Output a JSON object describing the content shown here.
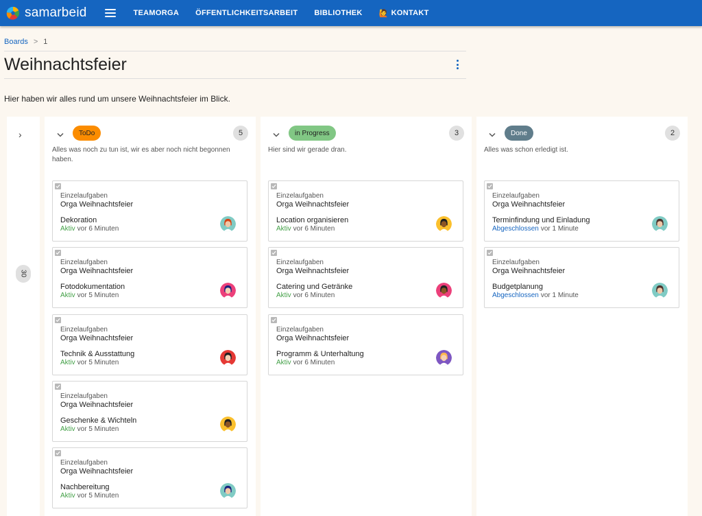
{
  "app": {
    "name": "samarbeid"
  },
  "nav": {
    "items": [
      {
        "label": "TEAMORGA"
      },
      {
        "label": "ÖFFENTLICHKEITSARBEIT"
      },
      {
        "label": "BIBLIOTHEK"
      },
      {
        "label": "KONTAKT",
        "emoji": "🙋"
      }
    ]
  },
  "breadcrumb": {
    "boards": "Boards",
    "sep": ">",
    "current": "1"
  },
  "page": {
    "title": "Weihnachtsfeier",
    "description": "Hier haben wir alles rund um unsere Weihnachtsfeier im Blick."
  },
  "collapsed_column": {
    "chevron": "›",
    "count": "30"
  },
  "columns": [
    {
      "label": "ToDo",
      "color": "#fb8c00",
      "text_color": "#222",
      "count": "5",
      "description": "Alles was noch zu tun ist, wir es aber noch nicht begonnen haben.",
      "cards": [
        {
          "category": "Einzelaufgaben",
          "project": "Orga Weihnachtsfeier",
          "task": "Dekoration",
          "status": "Aktiv",
          "status_type": "aktiv",
          "time": "vor 6 Minuten",
          "avatar_bg": "#80cbc4",
          "skin": "#f0c8a8",
          "hair": "#d84315"
        },
        {
          "category": "Einzelaufgaben",
          "project": "Orga Weihnachtsfeier",
          "task": "Fotodokumentation",
          "status": "Aktiv",
          "status_type": "aktiv",
          "time": "vor 5 Minuten",
          "avatar_bg": "#ec407a",
          "skin": "#f5d0b5",
          "hair": "#1a237e"
        },
        {
          "category": "Einzelaufgaben",
          "project": "Orga Weihnachtsfeier",
          "task": "Technik & Ausstattung",
          "status": "Aktiv",
          "status_type": "aktiv",
          "time": "vor 5 Minuten",
          "avatar_bg": "#e53935",
          "skin": "#f5d0b5",
          "hair": "#212121"
        },
        {
          "category": "Einzelaufgaben",
          "project": "Orga Weihnachtsfeier",
          "task": "Geschenke & Wichteln",
          "status": "Aktiv",
          "status_type": "aktiv",
          "time": "vor 5 Minuten",
          "avatar_bg": "#fbc02d",
          "skin": "#8d5524",
          "hair": "#212121"
        },
        {
          "category": "Einzelaufgaben",
          "project": "Orga Weihnachtsfeier",
          "task": "Nachbereitung",
          "status": "Aktiv",
          "status_type": "aktiv",
          "time": "vor 5 Minuten",
          "avatar_bg": "#80cbc4",
          "skin": "#f0c8a8",
          "hair": "#1a237e"
        }
      ]
    },
    {
      "label": "in Progress",
      "color": "#81c784",
      "text_color": "#222",
      "count": "3",
      "description": "Hier sind wir gerade dran.",
      "cards": [
        {
          "category": "Einzelaufgaben",
          "project": "Orga Weihnachtsfeier",
          "task": "Location organisieren",
          "status": "Aktiv",
          "status_type": "aktiv",
          "time": "vor 6 Minuten",
          "avatar_bg": "#fbc02d",
          "skin": "#8d5524",
          "hair": "#212121"
        },
        {
          "category": "Einzelaufgaben",
          "project": "Orga Weihnachtsfeier",
          "task": "Catering und Getränke",
          "status": "Aktiv",
          "status_type": "aktiv",
          "time": "vor 6 Minuten",
          "avatar_bg": "#ec407a",
          "skin": "#8d5524",
          "hair": "#212121"
        },
        {
          "category": "Einzelaufgaben",
          "project": "Orga Weihnachtsfeier",
          "task": "Programm & Unterhaltung",
          "status": "Aktiv",
          "status_type": "aktiv",
          "time": "vor 6 Minuten",
          "avatar_bg": "#7e57c2",
          "skin": "#f5d0b5",
          "hair": "#ffb74d"
        }
      ]
    },
    {
      "label": "Done",
      "color": "#607d8b",
      "text_color": "#fff",
      "count": "2",
      "description": "Alles was schon erledigt ist.",
      "cards": [
        {
          "category": "Einzelaufgaben",
          "project": "Orga Weihnachtsfeier",
          "task": "Terminfindung und Einladung",
          "status": "Abgeschlossen",
          "status_type": "done",
          "time": "vor 1 Minute",
          "avatar_bg": "#80cbc4",
          "skin": "#f0c8a8",
          "hair": "#4e342e"
        },
        {
          "category": "Einzelaufgaben",
          "project": "Orga Weihnachtsfeier",
          "task": "Budgetplanung",
          "status": "Abgeschlossen",
          "status_type": "done",
          "time": "vor 1 Minute",
          "avatar_bg": "#80cbc4",
          "skin": "#f0c8a8",
          "hair": "#4e342e"
        }
      ]
    }
  ]
}
